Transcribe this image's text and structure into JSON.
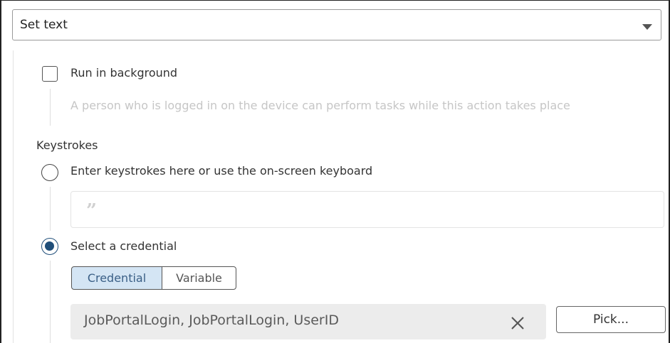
{
  "action_select": {
    "selected_value": "Set text",
    "icon": "chevron-down-icon"
  },
  "run_in_background": {
    "label": "Run in background",
    "checked": false,
    "description": "A person who is logged in on the device can perform tasks while this action takes place"
  },
  "keystrokes": {
    "heading": "Keystrokes",
    "option_manual": {
      "label": "Enter keystrokes here or use the on-screen keyboard",
      "selected": false,
      "input_icon": "quote-icon"
    },
    "option_credential": {
      "label": "Select a credential",
      "selected": true,
      "tabs": [
        "Credential",
        "Variable"
      ],
      "active_tab": "Credential",
      "value": "JobPortalLogin, JobPortalLogin, UserID",
      "clear_icon": "close-icon",
      "pick_label": "Pick..."
    }
  },
  "colors": {
    "accent": "#1f4e79",
    "active_tab_bg": "#d4e5f4",
    "muted_text": "#c6c6c6"
  }
}
